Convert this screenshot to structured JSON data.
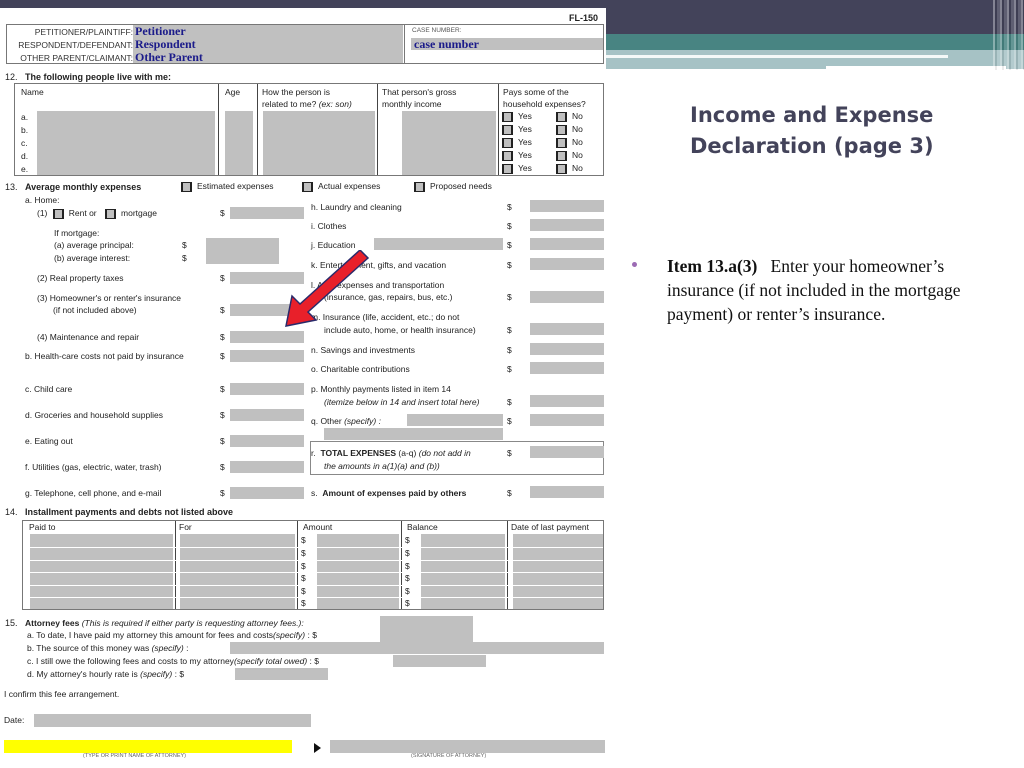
{
  "slide": {
    "title_line1": "Income and Expense",
    "title_line2": "Declaration (page 3)",
    "bullet": {
      "bold": "Item 13.a(3)",
      "text": "Enter your homeowner’s  insurance (if not included in the mortgage payment) or renter’s insurance."
    },
    "colors": {
      "header_dark": "#43435a",
      "header_teal": "#488482",
      "header_light": "#a6c2c5",
      "bullet": "#9c6bb4",
      "pointer_arrow": "#e8202a",
      "highlight": "#ffff00"
    }
  },
  "form": {
    "form_id": "FL-150",
    "caption": {
      "petitioner_label": "PETITIONER/PLAINTIFF:",
      "petitioner_value": "Petitioner",
      "respondent_label": "RESPONDENT/DEFENDANT:",
      "respondent_value": "Respondent",
      "other_label": "OTHER PARENT/CLAIMANT:",
      "other_value": "Other Parent",
      "case_number_label": "CASE NUMBER:",
      "case_number_value": "case number"
    },
    "section12": {
      "num": "12.",
      "title": "The following people live with me:",
      "headers": [
        "Name",
        "Age",
        "How the person is related to me? (ex: son)",
        "That person's gross monthly income",
        "Pays some of the household expenses?"
      ],
      "header_col3_a": "How the person is",
      "header_col3_b": "related to me?",
      "header_col3_c": "(ex: son)",
      "header_col4_a": "That person's gross",
      "header_col4_b": "monthly income",
      "header_col5_a": "Pays some of the",
      "header_col5_b": "household expenses?",
      "rows": [
        "a.",
        "b.",
        "c.",
        "d.",
        "e."
      ],
      "yes_label": "Yes",
      "no_label": "No"
    },
    "section13": {
      "num": "13.",
      "title": "Average monthly expenses",
      "options": [
        "Estimated expenses",
        "Actual expenses",
        "Proposed needs"
      ],
      "home_label": "a. Home:",
      "rent_prefix": "(1)",
      "rent_label": "Rent or",
      "mortgage_label": "mortgage",
      "if_mortgage": "If mortgage:",
      "principal": "(a)   average principal:",
      "interest": "(b)   average interest:",
      "taxes": "(2)  Real property taxes",
      "insurance_a": "(3)  Homeowner's or renter's insurance",
      "insurance_b": "(if not included above)",
      "maintenance": "(4)  Maintenance and repair",
      "left_items": [
        "b.  Health-care costs not paid by insurance",
        "c.  Child care",
        "d.  Groceries and household supplies",
        "e.  Eating out",
        "f.   Utilities (gas, electric, water, trash)",
        "g.  Telephone, cell phone, and e-mail"
      ],
      "right_items": {
        "h": "h.  Laundry and cleaning",
        "i": "i.   Clothes",
        "j": "j.   Education",
        "k": "k.  Entertainment, gifts, and vacation",
        "l_a": "l.   Auto expenses and transportation",
        "l_b": "(insurance, gas, repairs, bus, etc.)",
        "m_a": "m. Insurance (life, accident, etc.; do not",
        "m_b": "include auto, home, or health insurance)",
        "n": "n.  Savings and investments",
        "o": "o.  Charitable contributions",
        "p_a": "p.  Monthly payments listed in item 14",
        "p_b": "(itemize below in 14 and insert total here)",
        "q": "q.  Other",
        "q_italic": "(specify) :",
        "r_bold": "TOTAL EXPENSES",
        "r_prefix": "r.",
        "r_range": "(a-q)",
        "r_italic_a": "(do not add in",
        "r_italic_b": "the amounts in a(1)(a) and (b))",
        "s_prefix": "s.",
        "s_bold": "Amount of expenses paid by others"
      },
      "currency": "$"
    },
    "section14": {
      "num": "14.",
      "title": "Installment payments and debts not listed above",
      "headers": [
        "Paid to",
        "For",
        "Amount",
        "Balance",
        "Date of last payment"
      ],
      "row_count": 6,
      "currency": "$"
    },
    "section15": {
      "num": "15.",
      "title": "Attorney fees",
      "title_note": "(This is required if either party is requesting attorney fees.):",
      "a": "a.   To date, I have paid my attorney this amount for fees and costs",
      "a_italic": "(specify)",
      "a_tail": ": $",
      "b": "b.   The source of this money was",
      "b_italic": "(specify)",
      "b_tail": ":",
      "c": "c.   I still owe the following fees and costs to my attorney",
      "c_italic": "(specify total owed)",
      "c_tail": ": $",
      "d": "d.   My attorney's hourly rate is",
      "d_italic": "(specify)",
      "d_tail": ": $",
      "confirm": "I confirm this fee arrangement.",
      "date_label": "Date:",
      "name_caption": "(TYPE OR PRINT NAME OF ATTORNEY)",
      "signature_caption": "(SIGNATURE OF ATTORNEY)"
    }
  }
}
